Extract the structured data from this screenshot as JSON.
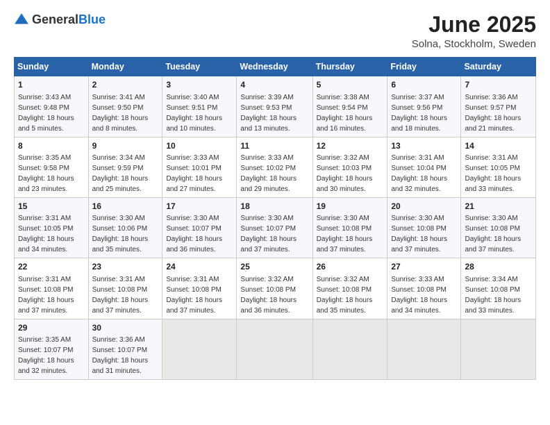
{
  "header": {
    "logo_general": "General",
    "logo_blue": "Blue",
    "title": "June 2025",
    "subtitle": "Solna, Stockholm, Sweden"
  },
  "weekdays": [
    "Sunday",
    "Monday",
    "Tuesday",
    "Wednesday",
    "Thursday",
    "Friday",
    "Saturday"
  ],
  "weeks": [
    [
      {
        "day": "1",
        "sunrise": "Sunrise: 3:43 AM",
        "sunset": "Sunset: 9:48 PM",
        "daylight": "Daylight: 18 hours and 5 minutes."
      },
      {
        "day": "2",
        "sunrise": "Sunrise: 3:41 AM",
        "sunset": "Sunset: 9:50 PM",
        "daylight": "Daylight: 18 hours and 8 minutes."
      },
      {
        "day": "3",
        "sunrise": "Sunrise: 3:40 AM",
        "sunset": "Sunset: 9:51 PM",
        "daylight": "Daylight: 18 hours and 10 minutes."
      },
      {
        "day": "4",
        "sunrise": "Sunrise: 3:39 AM",
        "sunset": "Sunset: 9:53 PM",
        "daylight": "Daylight: 18 hours and 13 minutes."
      },
      {
        "day": "5",
        "sunrise": "Sunrise: 3:38 AM",
        "sunset": "Sunset: 9:54 PM",
        "daylight": "Daylight: 18 hours and 16 minutes."
      },
      {
        "day": "6",
        "sunrise": "Sunrise: 3:37 AM",
        "sunset": "Sunset: 9:56 PM",
        "daylight": "Daylight: 18 hours and 18 minutes."
      },
      {
        "day": "7",
        "sunrise": "Sunrise: 3:36 AM",
        "sunset": "Sunset: 9:57 PM",
        "daylight": "Daylight: 18 hours and 21 minutes."
      }
    ],
    [
      {
        "day": "8",
        "sunrise": "Sunrise: 3:35 AM",
        "sunset": "Sunset: 9:58 PM",
        "daylight": "Daylight: 18 hours and 23 minutes."
      },
      {
        "day": "9",
        "sunrise": "Sunrise: 3:34 AM",
        "sunset": "Sunset: 9:59 PM",
        "daylight": "Daylight: 18 hours and 25 minutes."
      },
      {
        "day": "10",
        "sunrise": "Sunrise: 3:33 AM",
        "sunset": "Sunset: 10:01 PM",
        "daylight": "Daylight: 18 hours and 27 minutes."
      },
      {
        "day": "11",
        "sunrise": "Sunrise: 3:33 AM",
        "sunset": "Sunset: 10:02 PM",
        "daylight": "Daylight: 18 hours and 29 minutes."
      },
      {
        "day": "12",
        "sunrise": "Sunrise: 3:32 AM",
        "sunset": "Sunset: 10:03 PM",
        "daylight": "Daylight: 18 hours and 30 minutes."
      },
      {
        "day": "13",
        "sunrise": "Sunrise: 3:31 AM",
        "sunset": "Sunset: 10:04 PM",
        "daylight": "Daylight: 18 hours and 32 minutes."
      },
      {
        "day": "14",
        "sunrise": "Sunrise: 3:31 AM",
        "sunset": "Sunset: 10:05 PM",
        "daylight": "Daylight: 18 hours and 33 minutes."
      }
    ],
    [
      {
        "day": "15",
        "sunrise": "Sunrise: 3:31 AM",
        "sunset": "Sunset: 10:05 PM",
        "daylight": "Daylight: 18 hours and 34 minutes."
      },
      {
        "day": "16",
        "sunrise": "Sunrise: 3:30 AM",
        "sunset": "Sunset: 10:06 PM",
        "daylight": "Daylight: 18 hours and 35 minutes."
      },
      {
        "day": "17",
        "sunrise": "Sunrise: 3:30 AM",
        "sunset": "Sunset: 10:07 PM",
        "daylight": "Daylight: 18 hours and 36 minutes."
      },
      {
        "day": "18",
        "sunrise": "Sunrise: 3:30 AM",
        "sunset": "Sunset: 10:07 PM",
        "daylight": "Daylight: 18 hours and 37 minutes."
      },
      {
        "day": "19",
        "sunrise": "Sunrise: 3:30 AM",
        "sunset": "Sunset: 10:08 PM",
        "daylight": "Daylight: 18 hours and 37 minutes."
      },
      {
        "day": "20",
        "sunrise": "Sunrise: 3:30 AM",
        "sunset": "Sunset: 10:08 PM",
        "daylight": "Daylight: 18 hours and 37 minutes."
      },
      {
        "day": "21",
        "sunrise": "Sunrise: 3:30 AM",
        "sunset": "Sunset: 10:08 PM",
        "daylight": "Daylight: 18 hours and 37 minutes."
      }
    ],
    [
      {
        "day": "22",
        "sunrise": "Sunrise: 3:31 AM",
        "sunset": "Sunset: 10:08 PM",
        "daylight": "Daylight: 18 hours and 37 minutes."
      },
      {
        "day": "23",
        "sunrise": "Sunrise: 3:31 AM",
        "sunset": "Sunset: 10:08 PM",
        "daylight": "Daylight: 18 hours and 37 minutes."
      },
      {
        "day": "24",
        "sunrise": "Sunrise: 3:31 AM",
        "sunset": "Sunset: 10:08 PM",
        "daylight": "Daylight: 18 hours and 37 minutes."
      },
      {
        "day": "25",
        "sunrise": "Sunrise: 3:32 AM",
        "sunset": "Sunset: 10:08 PM",
        "daylight": "Daylight: 18 hours and 36 minutes."
      },
      {
        "day": "26",
        "sunrise": "Sunrise: 3:32 AM",
        "sunset": "Sunset: 10:08 PM",
        "daylight": "Daylight: 18 hours and 35 minutes."
      },
      {
        "day": "27",
        "sunrise": "Sunrise: 3:33 AM",
        "sunset": "Sunset: 10:08 PM",
        "daylight": "Daylight: 18 hours and 34 minutes."
      },
      {
        "day": "28",
        "sunrise": "Sunrise: 3:34 AM",
        "sunset": "Sunset: 10:08 PM",
        "daylight": "Daylight: 18 hours and 33 minutes."
      }
    ],
    [
      {
        "day": "29",
        "sunrise": "Sunrise: 3:35 AM",
        "sunset": "Sunset: 10:07 PM",
        "daylight": "Daylight: 18 hours and 32 minutes."
      },
      {
        "day": "30",
        "sunrise": "Sunrise: 3:36 AM",
        "sunset": "Sunset: 10:07 PM",
        "daylight": "Daylight: 18 hours and 31 minutes."
      },
      {
        "day": "",
        "sunrise": "",
        "sunset": "",
        "daylight": "",
        "empty": true
      },
      {
        "day": "",
        "sunrise": "",
        "sunset": "",
        "daylight": "",
        "empty": true
      },
      {
        "day": "",
        "sunrise": "",
        "sunset": "",
        "daylight": "",
        "empty": true
      },
      {
        "day": "",
        "sunrise": "",
        "sunset": "",
        "daylight": "",
        "empty": true
      },
      {
        "day": "",
        "sunrise": "",
        "sunset": "",
        "daylight": "",
        "empty": true
      }
    ]
  ]
}
